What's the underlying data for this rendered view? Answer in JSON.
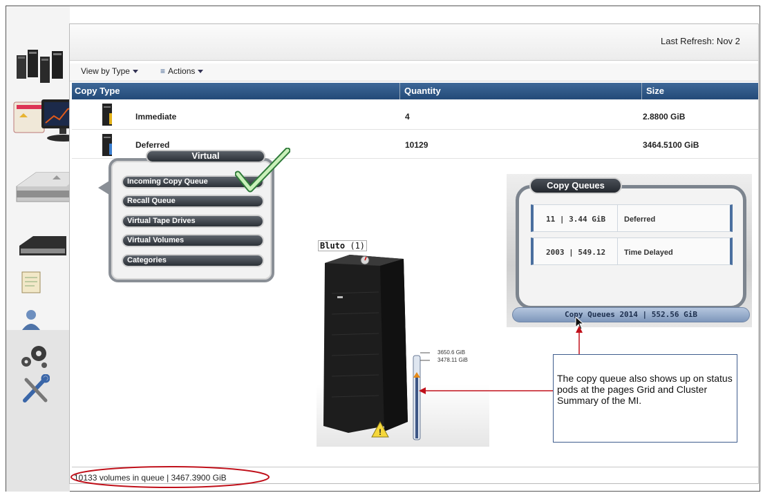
{
  "header": {
    "last_refresh": "Last Refresh: Nov 2"
  },
  "toolbar": {
    "view_by_type": "View by Type",
    "actions": "Actions"
  },
  "table": {
    "columns": [
      "Copy Type",
      "Quantity",
      "Size"
    ],
    "rows": [
      {
        "copy_type": "Immediate",
        "quantity": "4",
        "size": "2.8800 GiB"
      },
      {
        "copy_type": "Deferred",
        "quantity": "10129",
        "size": "3464.5100 GiB"
      }
    ]
  },
  "virtual_menu": {
    "title": "Virtual",
    "items": [
      "Incoming Copy Queue",
      "Recall Queue",
      "Virtual Tape Drives",
      "Virtual Volumes",
      "Categories"
    ]
  },
  "bluto": {
    "name": "Bluto",
    "count": "(1)",
    "gauge_top": "3650.6 GiB",
    "gauge_bottom": "3478.11 GiB"
  },
  "copy_queues_pod": {
    "title": "Copy Queues",
    "rows": [
      {
        "value": "11 | 3.44 GiB",
        "label": "Deferred"
      },
      {
        "value": "2003 | 549.12",
        "label": "Time Delayed"
      }
    ],
    "summary": "Copy Queues 2014 | 552.56 GiB"
  },
  "callout": {
    "text": "The copy queue also shows up on status pods at the pages Grid and Cluster Summary of the MI."
  },
  "footer": {
    "status": "10133 volumes in queue | 3467.3900 GiB"
  },
  "icons": {
    "sidebar": [
      "cluster-icon",
      "monitor-icon",
      "virtual-tape-icon",
      "physical-tape-icon",
      "constructs-icon",
      "access-icon",
      "settings-icon",
      "service-icon"
    ],
    "colors": {
      "header_blue": "#2d5585",
      "annotation_red": "#c0101a",
      "checkmark_green": "#3aa04a"
    }
  }
}
